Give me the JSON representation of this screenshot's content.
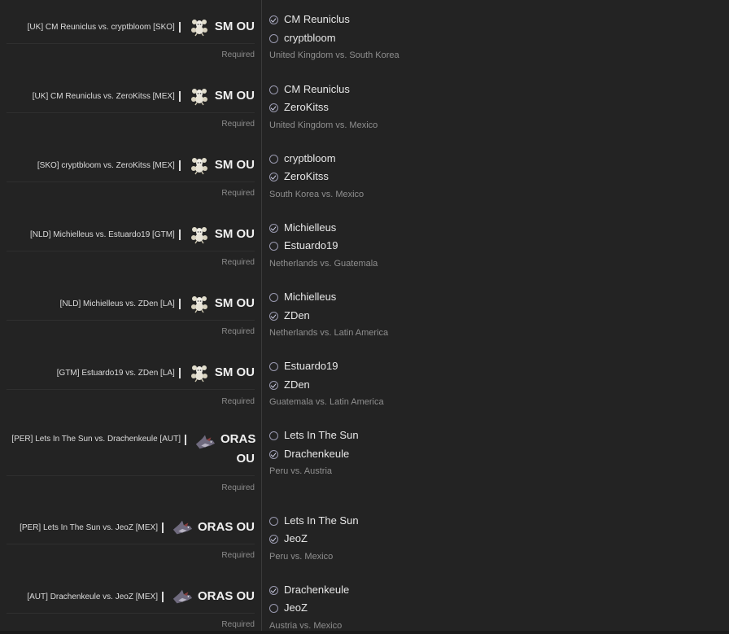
{
  "questions": [
    {
      "title": "[UK] CM Reuniclus vs. cryptbloom [SKO]",
      "tier": "SM OU",
      "sprite": "reuniclus",
      "required": "Required",
      "options": [
        "CM Reuniclus",
        "cryptbloom"
      ],
      "selected": 0,
      "subtitle": "United Kingdom vs. South Korea"
    },
    {
      "title": "[UK] CM Reuniclus vs. ZeroKitss [MEX]",
      "tier": "SM OU",
      "sprite": "reuniclus",
      "required": "Required",
      "options": [
        "CM Reuniclus",
        "ZeroKitss"
      ],
      "selected": 1,
      "subtitle": "United Kingdom vs. Mexico"
    },
    {
      "title": "[SKO] cryptbloom vs. ZeroKitss [MEX]",
      "tier": "SM OU",
      "sprite": "reuniclus",
      "required": "Required",
      "options": [
        "cryptbloom",
        "ZeroKitss"
      ],
      "selected": 1,
      "subtitle": "South Korea vs. Mexico"
    },
    {
      "title": "[NLD] Michielleus vs. Estuardo19 [GTM]",
      "tier": "SM OU",
      "sprite": "reuniclus",
      "required": "Required",
      "options": [
        "Michielleus",
        "Estuardo19"
      ],
      "selected": 0,
      "subtitle": "Netherlands vs. Guatemala"
    },
    {
      "title": "[NLD] Michielleus vs. ZDen [LA]",
      "tier": "SM OU",
      "sprite": "reuniclus",
      "required": "Required",
      "options": [
        "Michielleus",
        "ZDen"
      ],
      "selected": 1,
      "subtitle": "Netherlands vs. Latin America"
    },
    {
      "title": "[GTM] Estuardo19 vs. ZDen [LA]",
      "tier": "SM OU",
      "sprite": "reuniclus",
      "required": "Required",
      "options": [
        "Estuardo19",
        "ZDen"
      ],
      "selected": 1,
      "subtitle": "Guatemala vs. Latin America"
    },
    {
      "title": "[PER] Lets In The Sun vs. Drachenkeule [AUT]",
      "tier": "ORAS OU",
      "sprite": "shark",
      "required": "Required",
      "options": [
        "Lets In The Sun",
        "Drachenkeule"
      ],
      "selected": 1,
      "subtitle": "Peru vs. Austria"
    },
    {
      "title": "[PER] Lets In The Sun vs. JeoZ [MEX]",
      "tier": "ORAS OU",
      "sprite": "shark",
      "required": "Required",
      "options": [
        "Lets In The Sun",
        "JeoZ"
      ],
      "selected": 1,
      "subtitle": "Peru vs. Mexico"
    },
    {
      "title": "[AUT] Drachenkeule vs. JeoZ [MEX]",
      "tier": "ORAS OU",
      "sprite": "shark",
      "required": "Required",
      "options": [
        "Drachenkeule",
        "JeoZ"
      ],
      "selected": 0,
      "subtitle": "Austria vs. Mexico"
    }
  ]
}
